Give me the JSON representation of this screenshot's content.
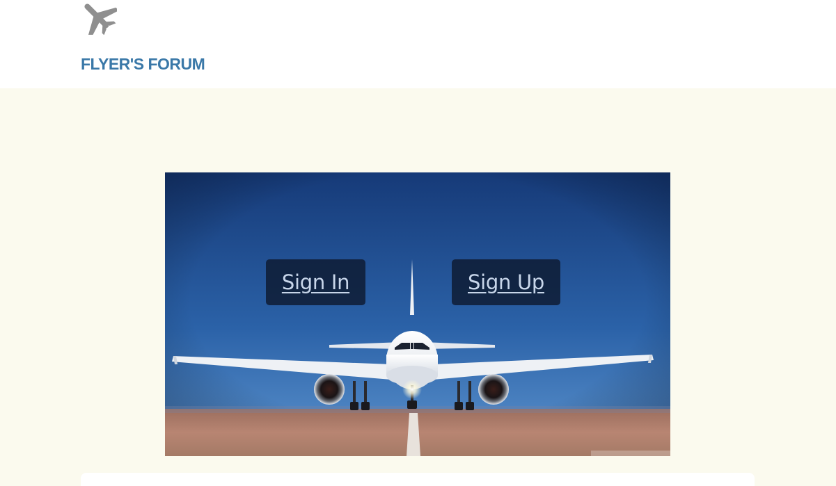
{
  "header": {
    "logo_icon": "airplane-icon",
    "brand": "FLYER'S FORUM"
  },
  "hero": {
    "image": "airplane-on-runway-photo",
    "sign_in_label": "Sign In",
    "sign_up_label": "Sign Up"
  },
  "colors": {
    "page_background": "#fbfaee",
    "header_background": "#ffffff",
    "brand_text": "#3a78a8",
    "icon_gray": "#8f8f8f",
    "button_background": "#0e1a30",
    "button_text": "#c8d6ea"
  }
}
